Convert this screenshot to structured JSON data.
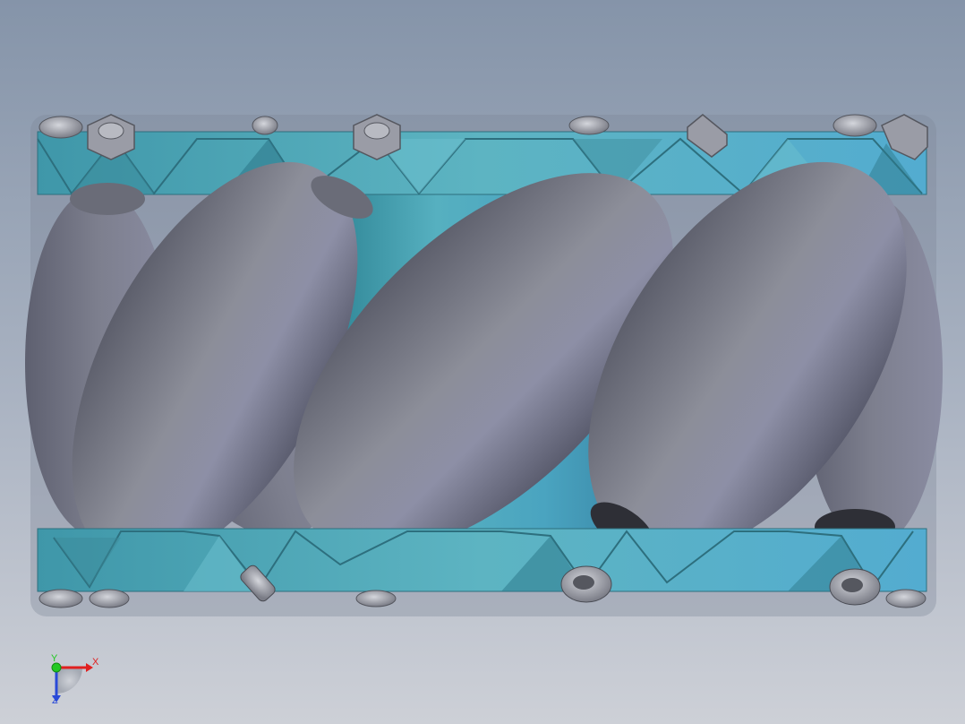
{
  "viewport": {
    "background_top": "#8796ab",
    "background_bottom": "#c9ccd4",
    "model": {
      "frame_color": "#4fa9bd",
      "frame_color_dark": "#3a8496",
      "hub_color": "#4aa2b6",
      "roller_color": "#8b8e9a",
      "roller_shadow": "#5f6170",
      "roller_highlight": "#a9abb8",
      "bolt_color": "#9c9ea8"
    }
  },
  "triad": {
    "x_label": "X",
    "y_label": "Y",
    "z_label": "Z",
    "x_color": "#e02020",
    "y_color": "#22c822",
    "z_color": "#2a4ad8"
  }
}
